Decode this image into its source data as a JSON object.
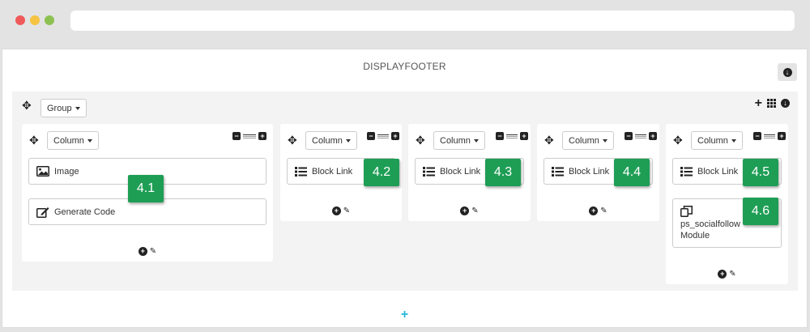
{
  "hook": {
    "title": "DISPLAYFOOTER"
  },
  "group": {
    "dropdown_label": "Group"
  },
  "columns": [
    {
      "dropdown_label": "Column",
      "modules": [
        {
          "icon": "image-icon",
          "label": "Image",
          "badge": "4.1"
        },
        {
          "icon": "edit-icon",
          "label": "Generate Code"
        }
      ]
    },
    {
      "dropdown_label": "Column",
      "modules": [
        {
          "icon": "list-icon",
          "label": "Block Link",
          "badge": "4.2"
        }
      ]
    },
    {
      "dropdown_label": "Column",
      "modules": [
        {
          "icon": "list-icon",
          "label": "Block Link",
          "badge": "4.3"
        }
      ]
    },
    {
      "dropdown_label": "Column",
      "modules": [
        {
          "icon": "list-icon",
          "label": "Block Link",
          "badge": "4.4"
        }
      ]
    },
    {
      "dropdown_label": "Column",
      "modules": [
        {
          "icon": "list-icon",
          "label": "Block Link",
          "badge": "4.5"
        },
        {
          "icon": "copy-icon",
          "label": "ps_socialfollow",
          "label2": "Module",
          "badge": "4.6"
        }
      ]
    }
  ],
  "colors": {
    "badge": "#1e9e55",
    "add_hook": "#25b9d7"
  }
}
